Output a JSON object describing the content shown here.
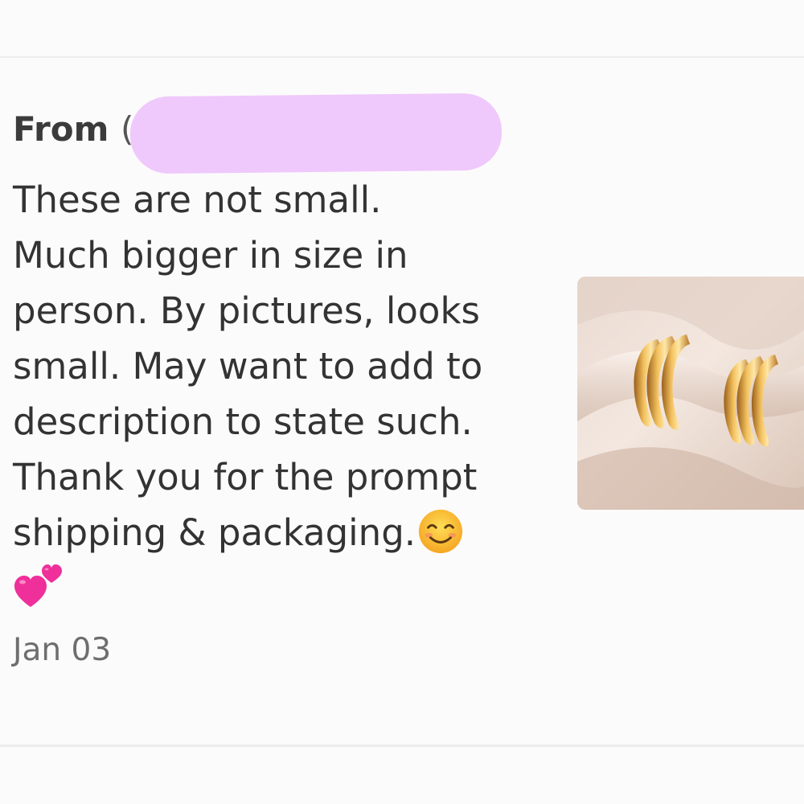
{
  "review": {
    "from_label": "From",
    "from_paren": "(",
    "text_lines": [
      "These are not small.",
      "Much bigger in size in",
      "person. By pictures, looks",
      "small. May want to add to",
      "description to state such.",
      "Thank you for the prompt",
      "shipping & packaging."
    ],
    "emojis": [
      "smiling-face-emoji",
      "two-hearts-emoji"
    ],
    "date": "Jan 03",
    "image": "gold-hoop-earrings-photo"
  },
  "colors": {
    "redaction": "#efc9fb",
    "text": "#333333",
    "date": "#6e6e6e",
    "background": "#fcfbfc",
    "divider": "#eeeceb"
  }
}
